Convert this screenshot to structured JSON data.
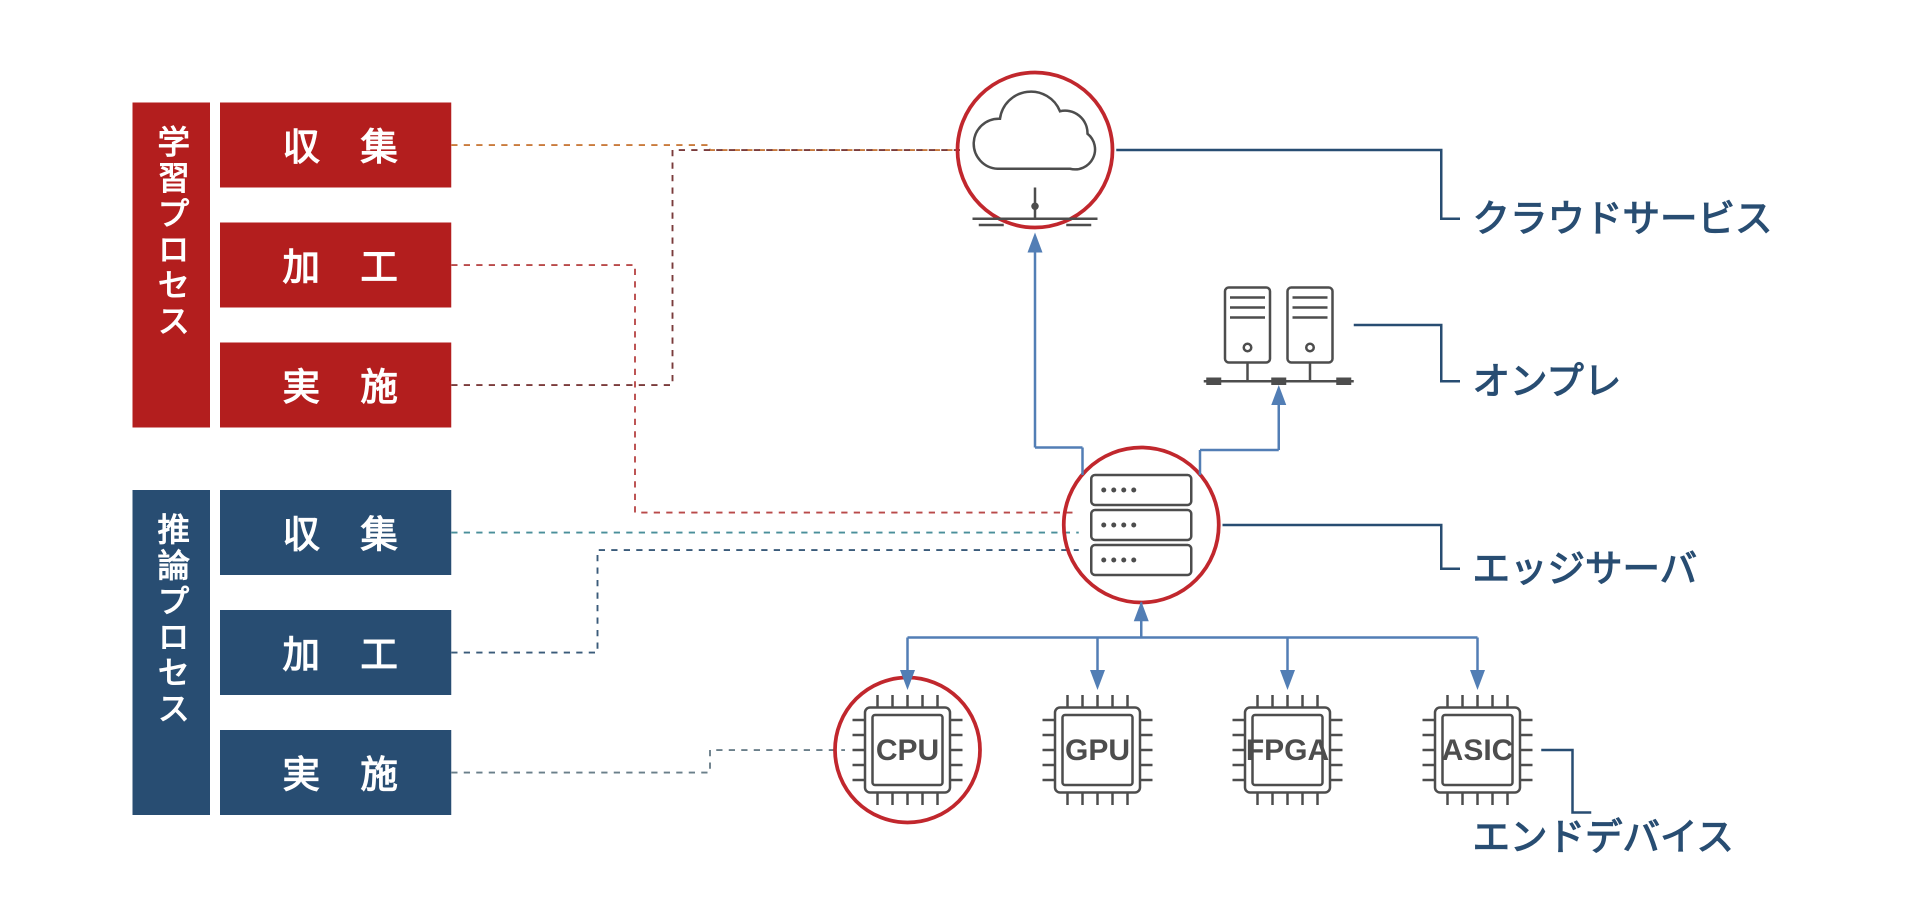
{
  "left": {
    "learning": {
      "header": "学習プロセス",
      "steps": [
        "収 集",
        "加 工",
        "実 施"
      ]
    },
    "inference": {
      "header": "推論プロセス",
      "steps": [
        "収 集",
        "加 工",
        "実 施"
      ]
    }
  },
  "right": {
    "cloud": "クラウドサービス",
    "onprem": "オンプレ",
    "edge": "エッジサーバ",
    "end": "エンドデバイス"
  },
  "chips": [
    "CPU",
    "GPU",
    "FPGA",
    "ASIC"
  ]
}
